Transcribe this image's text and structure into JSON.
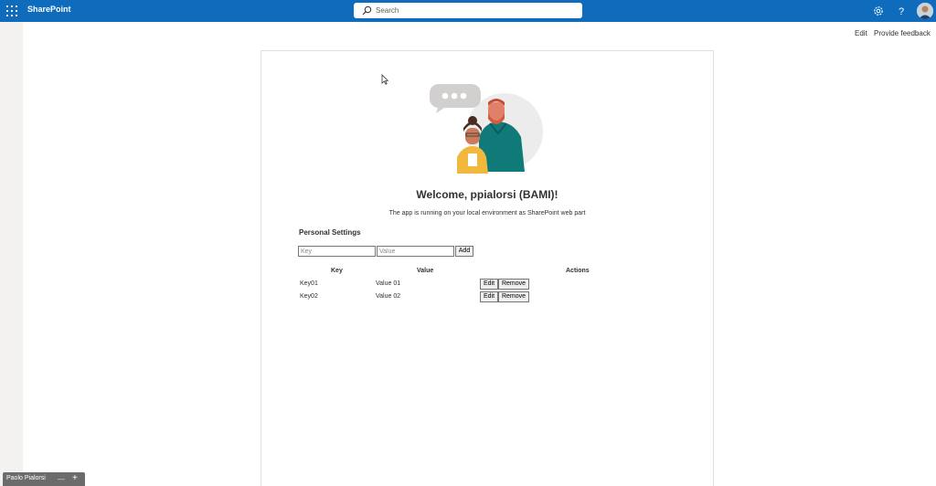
{
  "header": {
    "brand": "SharePoint",
    "search_placeholder": "Search",
    "icons": [
      "waffle-icon",
      "search-icon",
      "settings-gear-icon",
      "help-icon",
      "avatar"
    ],
    "color": "#0f6cbd"
  },
  "command_bar": {
    "edit": "Edit",
    "feedback": "Provide feedback"
  },
  "webpart": {
    "welcome": "Welcome, ppialorsi (BAMI)!",
    "subtitle": "The app is running on your local environment as SharePoint web part",
    "section_title": "Personal Settings",
    "key_placeholder": "Key",
    "value_placeholder": "Value",
    "add_label": "Add",
    "table": {
      "headers": [
        "Key",
        "Value",
        "Actions"
      ],
      "rows": [
        {
          "key": "Key01",
          "value": "Value 01",
          "edit": "Edit",
          "remove": "Remove"
        },
        {
          "key": "Key02",
          "value": "Value 02",
          "edit": "Edit",
          "remove": "Remove"
        }
      ]
    }
  },
  "taskbar": {
    "label": "Paolo Pialorsi",
    "minimize": "—",
    "plus": "+"
  }
}
